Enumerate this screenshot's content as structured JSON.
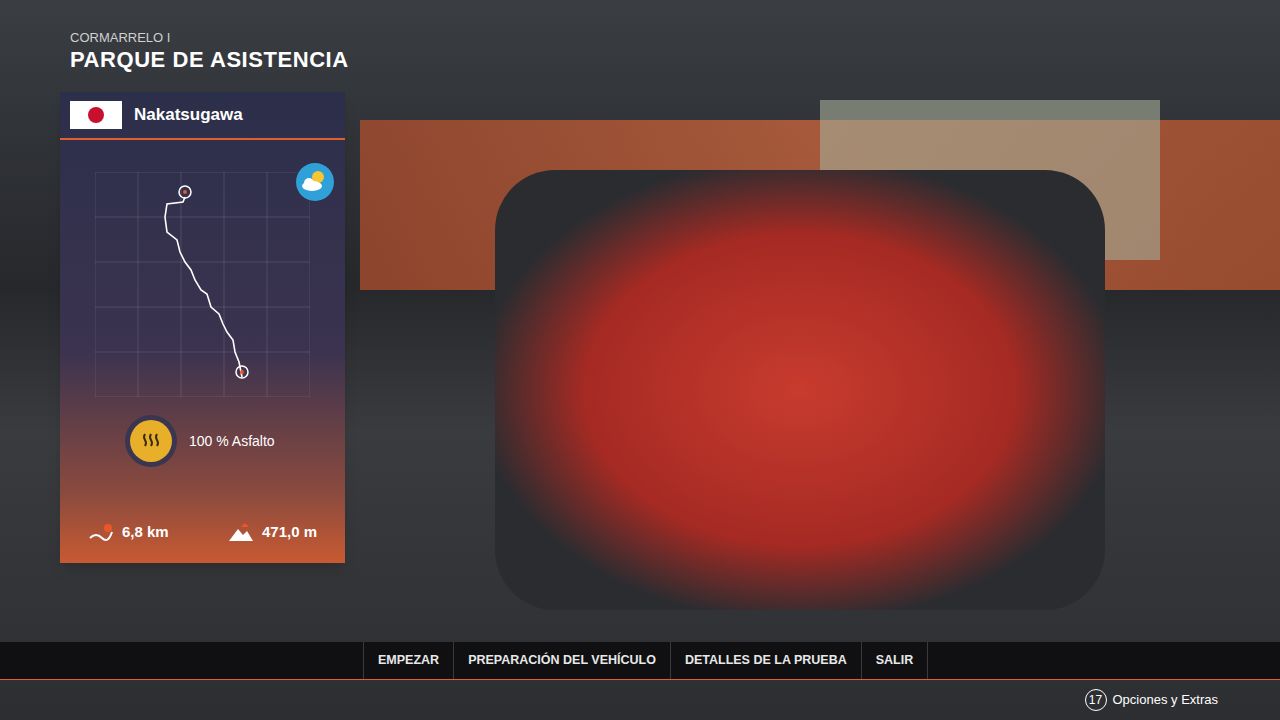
{
  "header": {
    "subtitle": "CORMARRELO I",
    "title": "PARQUE DE ASISTENCIA"
  },
  "stage": {
    "name": "Nakatsugawa",
    "surface": "100 % Asfalto",
    "distance": "6,8 km",
    "elevation": "471,0 m"
  },
  "menu": [
    {
      "label": "EMPEZAR",
      "selected": false
    },
    {
      "label": "PREPARACIÓN DEL VEHÍCULO",
      "selected": false
    },
    {
      "label": "DETALLES DE LA PRUEBA",
      "selected": false
    },
    {
      "label": "SALIR",
      "selected": false
    }
  ],
  "footer": {
    "badge": "17",
    "label": "Opciones y Extras"
  }
}
